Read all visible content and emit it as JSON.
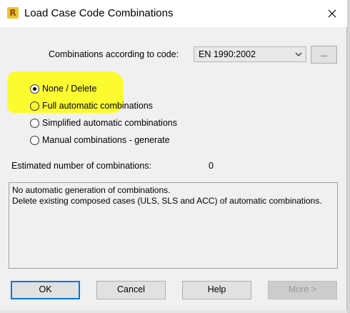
{
  "window": {
    "title": "Load Case Code Combinations",
    "app_icon": "revit-icon",
    "close_icon": "close-icon"
  },
  "code": {
    "label": "Combinations according to code:",
    "selected": "EN 1990:2002",
    "browse_label": "..."
  },
  "options": [
    {
      "label": "None / Delete",
      "checked": true
    },
    {
      "label": "Full automatic combinations",
      "checked": false
    },
    {
      "label": "Simplified automatic combinations",
      "checked": false
    },
    {
      "label": "Manual combinations - generate",
      "checked": false
    }
  ],
  "highlight_color": "#fcfb30",
  "estimate": {
    "label": "Estimated number of combinations:",
    "value": "0"
  },
  "description": {
    "lines": [
      "No automatic generation of combinations.",
      "Delete existing composed cases (ULS, SLS and ACC) of automatic combinations."
    ]
  },
  "buttons": {
    "ok": "OK",
    "cancel": "Cancel",
    "help": "Help",
    "more": "More >"
  },
  "colors": {
    "focus_border": "#0078d7",
    "dialog_bg": "#f0f0f0"
  }
}
